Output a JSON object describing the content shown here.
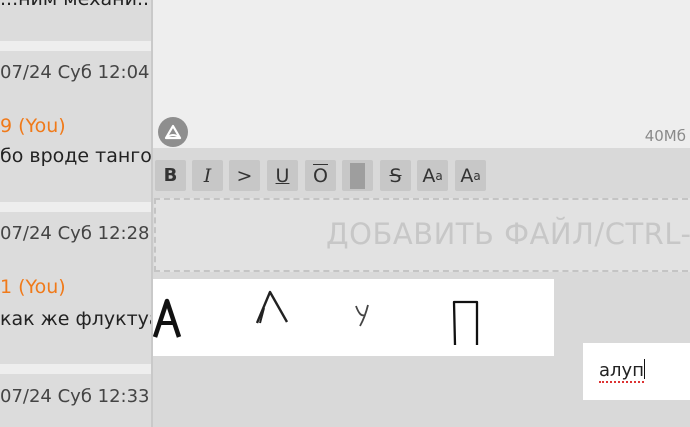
{
  "threads": {
    "top_partial_text": "...ним механи...",
    "posts": [
      {
        "date": "07/24 Суб 12:04",
        "name": "9 (You)",
        "text": "бо вроде танго"
      },
      {
        "date": "07/24 Суб 12:28",
        "name": "1 (You)",
        "text": "как же флуктуа"
      },
      {
        "date": "07/24 Суб 12:33",
        "name": "",
        "text": ""
      }
    ]
  },
  "form": {
    "counter": "40Мб",
    "toolbar": {
      "bold": "B",
      "italic": "I",
      "quote": ">",
      "underline": "U",
      "overline": "O",
      "spoiler": "",
      "strike": "S",
      "sup_base": "A",
      "sup_mark": "a",
      "sub_base": "A",
      "sub_mark": "a"
    },
    "dropzone": "ДОБАВИТЬ ФАЙЛ/CTRL-V",
    "captcha": {
      "letters": [
        "А",
        "Л",
        "У",
        "П"
      ],
      "input_value": "алуп"
    }
  },
  "colors": {
    "accent_name": "#f07a1a",
    "background": "#d9d9d9",
    "textarea": "#eeeeee",
    "toolbar_button": "#c7c7c7"
  }
}
